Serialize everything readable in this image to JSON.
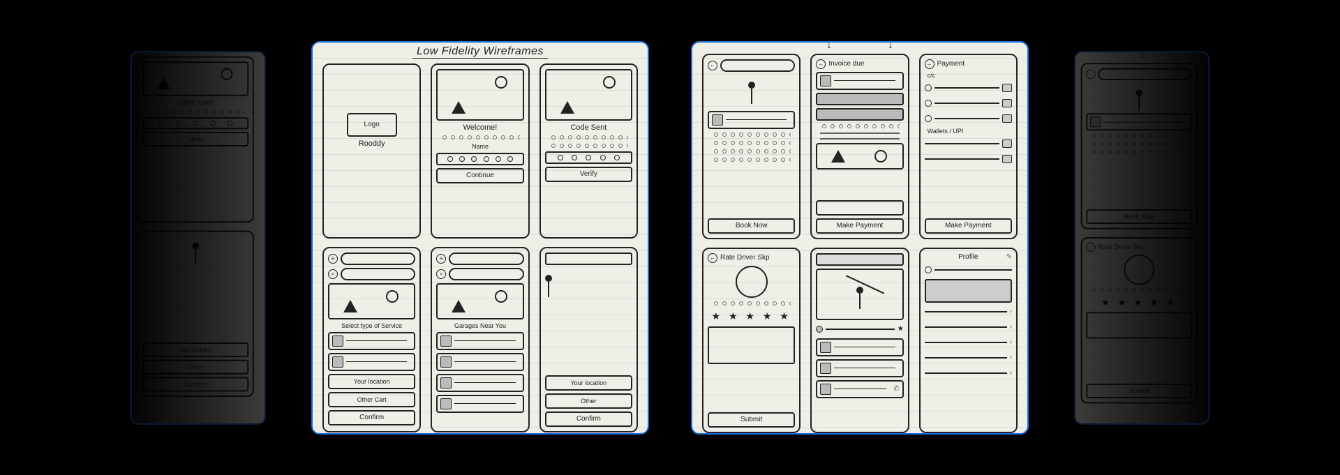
{
  "deck_title": "Low Fidelity Wireframes",
  "slideA": {
    "splash": {
      "logo_label": "Logo",
      "brand": "Rooddy"
    },
    "welcome": {
      "heading": "Welcome!",
      "name_label": "Name",
      "continue_btn": "Continue"
    },
    "otp": {
      "heading": "Code Sent",
      "verify_btn": "Verify"
    },
    "home": {
      "select_label": "Select type of Service",
      "your_location": "Your location",
      "other_label": "Other Cart",
      "confirm_btn": "Confirm"
    },
    "garages": {
      "section": "Garages Near You"
    },
    "pickloc": {
      "your_location": "Your location",
      "other_label": "Other",
      "confirm_btn": "Confirm"
    }
  },
  "slideB": {
    "dashboard": {
      "book_btn": "Book Now"
    },
    "invoice": {
      "title": "Invoice due",
      "pay_btn": "Make Payment"
    },
    "payment": {
      "title": "Payment",
      "cards_label": "c/c",
      "wallets_label": "Wallets / UPI",
      "pay_btn": "Make Payment"
    },
    "rate": {
      "title": "Rate Driver Skp",
      "submit_btn": "Submit"
    },
    "track": {},
    "profile": {
      "title": "Profile"
    }
  }
}
